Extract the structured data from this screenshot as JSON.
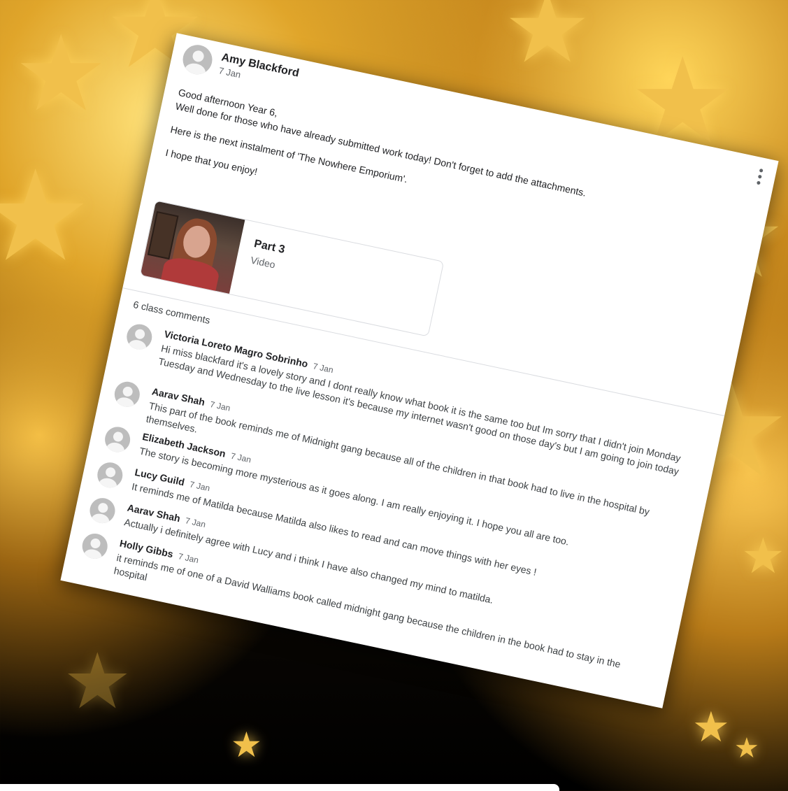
{
  "post": {
    "author": "Amy Blackford",
    "date": "7 Jan",
    "line1": "Good afternoon Year 6,",
    "line2": "Well done for those who have already submitted work today! Don't forget to add the attachments.",
    "line3": "Here is the next instalment of 'The Nowhere Emporium'.",
    "line4": "I hope that you enjoy!",
    "menu_icon": "more-vert-icon"
  },
  "attachment": {
    "title": "Part 3",
    "type": "Video"
  },
  "comments_header": "6 class comments",
  "comments": [
    {
      "name": "Victoria Loreto Magro Sobrinho",
      "date": "7 Jan",
      "text": "Hi miss blackfard it's a lovely story and I dont really know what book it is the same too but Im sorry that I didn't join Monday Tuesday and Wednesday to the live lesson it's because my internet wasn't good on those day's but I am going to join today"
    },
    {
      "name": "Aarav Shah",
      "date": "7 Jan",
      "text": "This part of the book reminds me of Midnight gang because all of the children in that book had to live in the hospital by themselves."
    },
    {
      "name": "Elizabeth Jackson",
      "date": "7 Jan",
      "text": "The story is becoming more mysterious as it goes along. I am really enjoying it. I hope you all are too."
    },
    {
      "name": "Lucy Guild",
      "date": "7 Jan",
      "text": "It reminds me of Matilda because Matilda also likes to read and can move things with her eyes !"
    },
    {
      "name": "Aarav Shah",
      "date": "7 Jan",
      "text": "Actually i definitely  agree with Lucy and i think I have also changed my mind to matilda."
    },
    {
      "name": "Holly Gibbs",
      "date": "7 Jan",
      "text": "it reminds me of one of a David Walliams book called midnight gang because the children in the book had to stay in the hospital"
    }
  ]
}
